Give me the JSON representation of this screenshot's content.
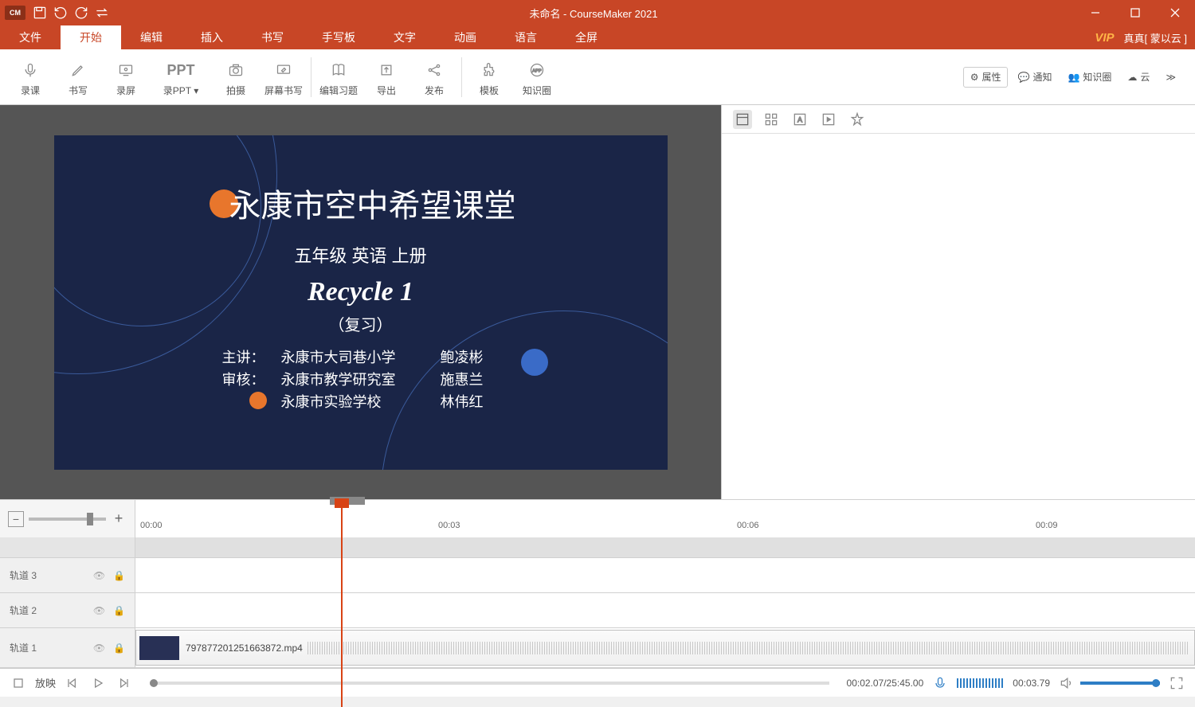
{
  "titlebar": {
    "logo": "CM",
    "title": "未命名 - CourseMaker 2021"
  },
  "menu": {
    "tabs": [
      "文件",
      "开始",
      "编辑",
      "插入",
      "书写",
      "手写板",
      "文字",
      "动画",
      "语言",
      "全屏"
    ],
    "active": 1,
    "vip": "VIP",
    "user": "真真[ 蒙以云 ]"
  },
  "ribbon": {
    "buttons": [
      "录课",
      "书写",
      "录屏",
      "录PPT",
      "拍摄",
      "屏幕书写",
      "编辑习题",
      "导出",
      "发布",
      "模板",
      "知识圈"
    ],
    "right": {
      "properties": "属性",
      "notify": "通知",
      "knowledge": "知识圈",
      "cloud": "云"
    }
  },
  "slide": {
    "title": "永康市空中希望课堂",
    "grade": "五年级  英语  上册",
    "recycle": "Recycle 1",
    "review": "（复习）",
    "lecturer_k": "主讲：",
    "lecturer_school": "永康市大司巷小学",
    "lecturer_name": "鲍凌彬",
    "reviewer_k": "审核：",
    "reviewer1_school": "永康市教学研究室",
    "reviewer1_name": "施惠兰",
    "reviewer2_school": "永康市实验学校",
    "reviewer2_name": "林伟红"
  },
  "timeline": {
    "ticks": [
      "00:00",
      "00:03",
      "00:06",
      "00:09"
    ],
    "tracks": [
      {
        "label": "轨道 3"
      },
      {
        "label": "轨道 2"
      },
      {
        "label": "轨道 1",
        "clip": "797877201251663872.mp4"
      }
    ]
  },
  "playbar": {
    "label": "放映",
    "time1": "00:02.07/25:45.00",
    "time2": "00:03.79"
  }
}
